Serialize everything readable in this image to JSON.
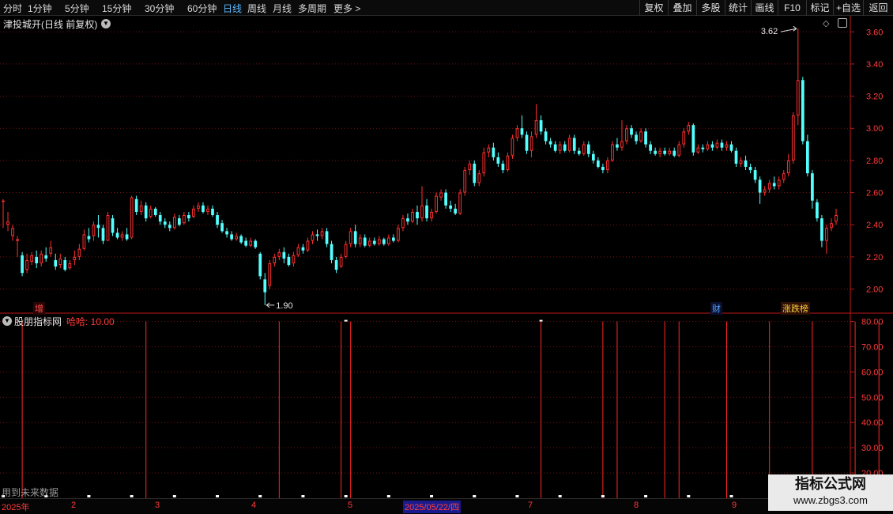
{
  "toolbar": {
    "periods": [
      "分时",
      "1分钟",
      "5分钟",
      "15分钟",
      "30分钟",
      "60分钟",
      "日线",
      "周线",
      "月线",
      "多周期",
      "更多 >"
    ],
    "active_period": "日线",
    "right": [
      "复权",
      "叠加",
      "多股",
      "统计",
      "画线",
      "F10",
      "标记",
      "+自选",
      "返回"
    ]
  },
  "main_chart": {
    "title": "津投城开(日线 前复权)",
    "high_label": "3.62",
    "low_label": "1.90",
    "y_ticks": [
      "3.60",
      "3.40",
      "3.20",
      "3.00",
      "2.80",
      "2.60",
      "2.40",
      "2.20",
      "2.00"
    ],
    "tags": {
      "zeng": "增",
      "cai": "财",
      "zhangdie": "涨跌榜"
    },
    "colors": {
      "up": "#ff3030",
      "down": "#54ffff",
      "grid": "#7a1010"
    }
  },
  "chart_data": {
    "type": "candlestick",
    "price_range": [
      1.86,
      3.68
    ],
    "max": 3.62,
    "min": 1.9,
    "candles": [
      [
        2.55,
        2.55,
        2.56,
        2.38
      ],
      [
        2.4,
        2.42,
        2.48,
        2.36
      ],
      [
        2.33,
        2.38,
        2.4,
        2.3
      ],
      [
        2.3,
        2.31,
        2.33,
        2.2
      ],
      [
        2.21,
        2.1,
        2.23,
        2.08
      ],
      [
        2.12,
        2.18,
        2.22,
        2.1
      ],
      [
        2.17,
        2.21,
        2.23,
        2.15
      ],
      [
        2.2,
        2.16,
        2.24,
        2.13
      ],
      [
        2.16,
        2.22,
        2.24,
        2.14
      ],
      [
        2.21,
        2.19,
        2.26,
        2.17
      ],
      [
        2.22,
        2.26,
        2.3,
        2.2
      ],
      [
        2.18,
        2.14,
        2.22,
        2.12
      ],
      [
        2.15,
        2.19,
        2.22,
        2.13
      ],
      [
        2.18,
        2.12,
        2.2,
        2.11
      ],
      [
        2.13,
        2.16,
        2.18,
        2.12
      ],
      [
        2.18,
        2.2,
        2.24,
        2.15
      ],
      [
        2.2,
        2.25,
        2.28,
        2.18
      ],
      [
        2.25,
        2.34,
        2.37,
        2.24
      ],
      [
        2.33,
        2.31,
        2.38,
        2.29
      ],
      [
        2.33,
        2.4,
        2.42,
        2.3
      ],
      [
        2.4,
        2.38,
        2.46,
        2.32
      ],
      [
        2.38,
        2.3,
        2.4,
        2.28
      ],
      [
        2.3,
        2.46,
        2.48,
        2.3
      ],
      [
        2.44,
        2.35,
        2.46,
        2.33
      ],
      [
        2.35,
        2.32,
        2.38,
        2.31
      ],
      [
        2.32,
        2.34,
        2.36,
        2.3
      ],
      [
        2.34,
        2.31,
        2.38,
        2.3
      ],
      [
        2.32,
        2.57,
        2.58,
        2.31
      ],
      [
        2.56,
        2.48,
        2.58,
        2.46
      ],
      [
        2.48,
        2.52,
        2.55,
        2.46
      ],
      [
        2.52,
        2.44,
        2.54,
        2.42
      ],
      [
        2.45,
        2.5,
        2.52,
        2.44
      ],
      [
        2.5,
        2.46,
        2.51,
        2.45
      ],
      [
        2.46,
        2.42,
        2.48,
        2.4
      ],
      [
        2.42,
        2.4,
        2.44,
        2.38
      ],
      [
        2.4,
        2.38,
        2.42,
        2.36
      ],
      [
        2.38,
        2.45,
        2.47,
        2.37
      ],
      [
        2.44,
        2.4,
        2.46,
        2.39
      ],
      [
        2.41,
        2.46,
        2.48,
        2.4
      ],
      [
        2.46,
        2.44,
        2.48,
        2.42
      ],
      [
        2.45,
        2.5,
        2.52,
        2.44
      ],
      [
        2.5,
        2.52,
        2.54,
        2.48
      ],
      [
        2.52,
        2.48,
        2.54,
        2.47
      ],
      [
        2.48,
        2.5,
        2.52,
        2.46
      ],
      [
        2.5,
        2.46,
        2.52,
        2.45
      ],
      [
        2.46,
        2.4,
        2.48,
        2.38
      ],
      [
        2.41,
        2.36,
        2.43,
        2.35
      ],
      [
        2.36,
        2.34,
        2.38,
        2.32
      ],
      [
        2.34,
        2.31,
        2.36,
        2.3
      ],
      [
        2.31,
        2.33,
        2.35,
        2.3
      ],
      [
        2.33,
        2.29,
        2.34,
        2.28
      ],
      [
        2.3,
        2.27,
        2.32,
        2.26
      ],
      [
        2.27,
        2.3,
        2.32,
        2.26
      ],
      [
        2.3,
        2.26,
        2.31,
        2.25
      ],
      [
        2.22,
        2.08,
        2.23,
        2.06
      ],
      [
        2.06,
        1.98,
        2.1,
        1.9
      ],
      [
        2.02,
        2.16,
        2.18,
        2.0
      ],
      [
        2.16,
        2.2,
        2.22,
        2.14
      ],
      [
        2.2,
        2.23,
        2.25,
        2.18
      ],
      [
        2.23,
        2.19,
        2.26,
        2.16
      ],
      [
        2.2,
        2.15,
        2.22,
        2.14
      ],
      [
        2.16,
        2.21,
        2.23,
        2.14
      ],
      [
        2.21,
        2.26,
        2.28,
        2.2
      ],
      [
        2.26,
        2.24,
        2.28,
        2.22
      ],
      [
        2.24,
        2.3,
        2.32,
        2.23
      ],
      [
        2.3,
        2.34,
        2.36,
        2.28
      ],
      [
        2.34,
        2.33,
        2.37,
        2.3
      ],
      [
        2.33,
        2.36,
        2.38,
        2.31
      ],
      [
        2.36,
        2.28,
        2.38,
        2.26
      ],
      [
        2.28,
        2.18,
        2.3,
        2.16
      ],
      [
        2.18,
        2.12,
        2.2,
        2.1
      ],
      [
        2.14,
        2.2,
        2.22,
        2.13
      ],
      [
        2.2,
        2.28,
        2.3,
        2.19
      ],
      [
        2.28,
        2.36,
        2.38,
        2.26
      ],
      [
        2.36,
        2.28,
        2.4,
        2.26
      ],
      [
        2.28,
        2.32,
        2.34,
        2.26
      ],
      [
        2.32,
        2.27,
        2.34,
        2.26
      ],
      [
        2.27,
        2.3,
        2.32,
        2.26
      ],
      [
        2.3,
        2.28,
        2.32,
        2.27
      ],
      [
        2.28,
        2.31,
        2.33,
        2.27
      ],
      [
        2.31,
        2.28,
        2.32,
        2.27
      ],
      [
        2.28,
        2.32,
        2.34,
        2.27
      ],
      [
        2.32,
        2.3,
        2.34,
        2.29
      ],
      [
        2.3,
        2.38,
        2.4,
        2.29
      ],
      [
        2.38,
        2.44,
        2.46,
        2.36
      ],
      [
        2.44,
        2.42,
        2.47,
        2.4
      ],
      [
        2.42,
        2.48,
        2.5,
        2.41
      ],
      [
        2.48,
        2.44,
        2.52,
        2.4
      ],
      [
        2.44,
        2.52,
        2.64,
        2.42
      ],
      [
        2.52,
        2.44,
        2.56,
        2.42
      ],
      [
        2.44,
        2.48,
        2.5,
        2.42
      ],
      [
        2.48,
        2.58,
        2.6,
        2.47
      ],
      [
        2.57,
        2.6,
        2.62,
        2.55
      ],
      [
        2.6,
        2.52,
        2.62,
        2.5
      ],
      [
        2.52,
        2.5,
        2.55,
        2.48
      ],
      [
        2.5,
        2.47,
        2.53,
        2.46
      ],
      [
        2.47,
        2.6,
        2.62,
        2.46
      ],
      [
        2.6,
        2.74,
        2.76,
        2.58
      ],
      [
        2.74,
        2.78,
        2.8,
        2.71
      ],
      [
        2.78,
        2.66,
        2.8,
        2.64
      ],
      [
        2.66,
        2.72,
        2.74,
        2.64
      ],
      [
        2.72,
        2.85,
        2.88,
        2.7
      ],
      [
        2.85,
        2.88,
        2.9,
        2.82
      ],
      [
        2.88,
        2.82,
        2.91,
        2.8
      ],
      [
        2.82,
        2.78,
        2.85,
        2.76
      ],
      [
        2.78,
        2.74,
        2.8,
        2.72
      ],
      [
        2.74,
        2.83,
        2.85,
        2.73
      ],
      [
        2.83,
        2.94,
        2.96,
        2.81
      ],
      [
        2.94,
        3.0,
        3.02,
        2.92
      ],
      [
        3.0,
        2.96,
        3.08,
        2.94
      ],
      [
        2.96,
        2.86,
        2.98,
        2.84
      ],
      [
        2.86,
        2.95,
        2.98,
        2.82
      ],
      [
        2.96,
        3.05,
        3.15,
        2.94
      ],
      [
        3.05,
        2.98,
        3.08,
        2.96
      ],
      [
        2.98,
        2.92,
        3.0,
        2.9
      ],
      [
        2.92,
        2.9,
        2.94,
        2.88
      ],
      [
        2.9,
        2.86,
        2.92,
        2.85
      ],
      [
        2.86,
        2.9,
        2.92,
        2.84
      ],
      [
        2.9,
        2.86,
        2.92,
        2.85
      ],
      [
        2.86,
        2.94,
        2.96,
        2.85
      ],
      [
        2.94,
        2.86,
        2.96,
        2.84
      ],
      [
        2.86,
        2.84,
        2.88,
        2.83
      ],
      [
        2.84,
        2.9,
        2.92,
        2.83
      ],
      [
        2.9,
        2.84,
        2.92,
        2.82
      ],
      [
        2.84,
        2.8,
        2.86,
        2.78
      ],
      [
        2.8,
        2.76,
        2.82,
        2.75
      ],
      [
        2.76,
        2.74,
        2.78,
        2.72
      ],
      [
        2.74,
        2.8,
        2.82,
        2.72
      ],
      [
        2.8,
        2.9,
        2.92,
        2.79
      ],
      [
        2.9,
        2.88,
        2.94,
        2.86
      ],
      [
        2.88,
        2.92,
        3.05,
        2.86
      ],
      [
        2.92,
        3.0,
        3.02,
        2.9
      ],
      [
        3.0,
        2.96,
        3.02,
        2.94
      ],
      [
        2.96,
        2.92,
        2.98,
        2.9
      ],
      [
        2.92,
        2.98,
        3.0,
        2.91
      ],
      [
        2.98,
        2.9,
        3.0,
        2.88
      ],
      [
        2.9,
        2.86,
        2.92,
        2.84
      ],
      [
        2.86,
        2.84,
        2.88,
        2.83
      ],
      [
        2.84,
        2.86,
        2.88,
        2.82
      ],
      [
        2.86,
        2.84,
        2.88,
        2.83
      ],
      [
        2.84,
        2.86,
        2.88,
        2.83
      ],
      [
        2.86,
        2.83,
        2.88,
        2.82
      ],
      [
        2.83,
        2.9,
        2.92,
        2.82
      ],
      [
        2.9,
        2.98,
        3.0,
        2.88
      ],
      [
        2.98,
        3.02,
        3.04,
        2.96
      ],
      [
        3.02,
        2.85,
        3.03,
        2.83
      ],
      [
        2.85,
        2.88,
        2.9,
        2.84
      ],
      [
        2.88,
        2.87,
        2.9,
        2.85
      ],
      [
        2.87,
        2.9,
        2.92,
        2.86
      ],
      [
        2.9,
        2.88,
        2.92,
        2.86
      ],
      [
        2.88,
        2.91,
        2.93,
        2.87
      ],
      [
        2.91,
        2.88,
        2.93,
        2.86
      ],
      [
        2.88,
        2.9,
        2.92,
        2.86
      ],
      [
        2.9,
        2.86,
        2.92,
        2.85
      ],
      [
        2.86,
        2.78,
        2.88,
        2.76
      ],
      [
        2.78,
        2.8,
        2.82,
        2.76
      ],
      [
        2.8,
        2.76,
        2.83,
        2.74
      ],
      [
        2.76,
        2.74,
        2.78,
        2.72
      ],
      [
        2.74,
        2.68,
        2.76,
        2.66
      ],
      [
        2.68,
        2.6,
        2.7,
        2.53
      ],
      [
        2.6,
        2.62,
        2.64,
        2.58
      ],
      [
        2.62,
        2.66,
        2.68,
        2.6
      ],
      [
        2.66,
        2.64,
        2.7,
        2.62
      ],
      [
        2.64,
        2.68,
        2.7,
        2.62
      ],
      [
        2.68,
        2.72,
        2.74,
        2.66
      ],
      [
        2.72,
        2.8,
        2.84,
        2.7
      ],
      [
        2.8,
        3.08,
        3.1,
        2.78
      ],
      [
        3.08,
        3.3,
        3.62,
        3.02
      ],
      [
        3.3,
        2.92,
        3.32,
        2.9
      ],
      [
        2.92,
        2.72,
        2.96,
        2.7
      ],
      [
        2.72,
        2.55,
        2.74,
        2.5
      ],
      [
        2.54,
        2.44,
        2.56,
        2.42
      ],
      [
        2.44,
        2.3,
        2.46,
        2.26
      ],
      [
        2.3,
        2.38,
        2.4,
        2.22
      ],
      [
        2.38,
        2.41,
        2.44,
        2.36
      ],
      [
        2.42,
        2.46,
        2.5,
        2.4
      ]
    ]
  },
  "indicator": {
    "name": "股朋指标网",
    "value_label": "哈哈: 10.00",
    "y_ticks": [
      "80.00",
      "70.00",
      "60.00",
      "50.00",
      "40.00",
      "30.00",
      "20.00"
    ],
    "signal_candle_indexes": [
      4,
      30,
      58,
      71,
      73,
      113,
      126,
      129,
      139,
      142,
      152,
      161,
      170,
      179,
      184
    ]
  },
  "footer": {
    "future_note": "用到未来数据",
    "x_labels": [
      "2025年",
      "2",
      "3",
      "4",
      "5",
      "2025/05/22/四",
      "7",
      "8",
      "9"
    ]
  },
  "watermark": {
    "line1": "指标公式网",
    "line2": "www.zbgs3.com"
  }
}
